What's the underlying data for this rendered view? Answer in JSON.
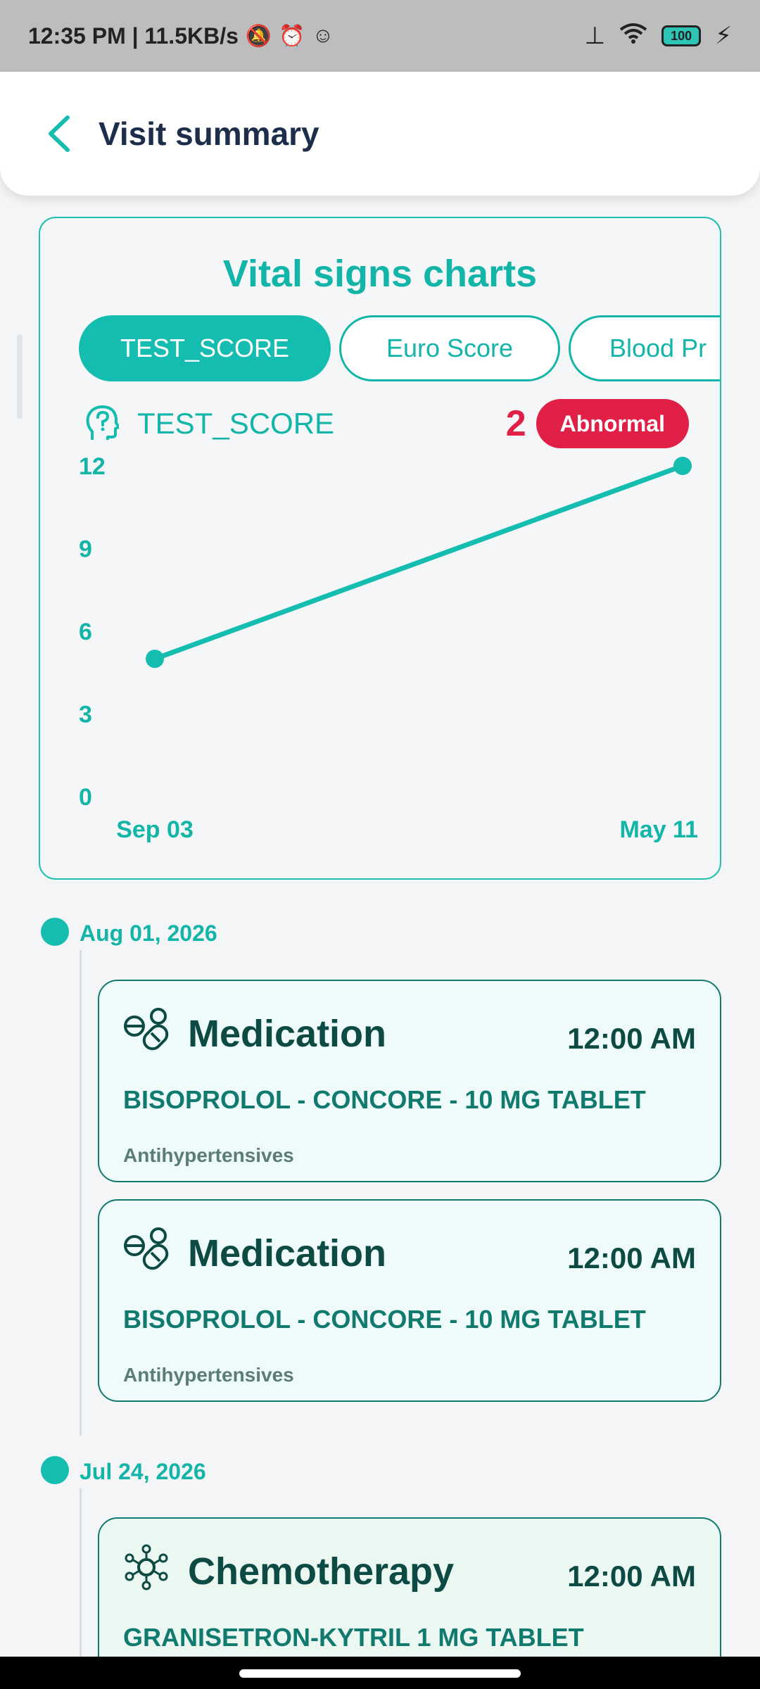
{
  "status_bar": {
    "time_speed": "12:35 PM | 11.5KB/s",
    "battery": "100"
  },
  "header": {
    "title": "Visit summary"
  },
  "vitals": {
    "title": "Vital signs charts",
    "tabs": [
      {
        "label": "TEST_SCORE",
        "active": true
      },
      {
        "label": "Euro Score",
        "active": false
      },
      {
        "label": "Blood Pr",
        "active": false
      }
    ],
    "metric": {
      "name": "TEST_SCORE",
      "value": "2",
      "status": "Abnormal"
    }
  },
  "chart_data": {
    "type": "line",
    "x": [
      "Sep 03",
      "May 11"
    ],
    "series": [
      {
        "values": [
          5,
          12
        ]
      }
    ],
    "yticks": [
      "12",
      "9",
      "6",
      "3",
      "0"
    ],
    "ylim": [
      0,
      12
    ],
    "title": "",
    "xlabel": "",
    "ylabel": "",
    "color": "#15bdb0"
  },
  "timeline": [
    {
      "date": "Aug 01, 2026",
      "events": [
        {
          "type": "Medication",
          "time": "12:00 AM",
          "name": "BISOPROLOL - CONCORE - 10 MG TABLET",
          "class": "Antihypertensives",
          "icon": "pills-icon"
        },
        {
          "type": "Medication",
          "time": "12:00 AM",
          "name": "BISOPROLOL - CONCORE - 10 MG TABLET",
          "class": "Antihypertensives",
          "icon": "pills-icon"
        }
      ]
    },
    {
      "date": "Jul 24, 2026",
      "events": [
        {
          "type": "Chemotherapy",
          "time": "12:00 AM",
          "name": "GRANISETRON-KYTRIL 1 MG TABLET",
          "icon": "molecule-icon"
        }
      ]
    }
  ],
  "colors": {
    "accent": "#15bdb0",
    "abnormal": "#e02046",
    "dark_text": "#0d4a44"
  }
}
